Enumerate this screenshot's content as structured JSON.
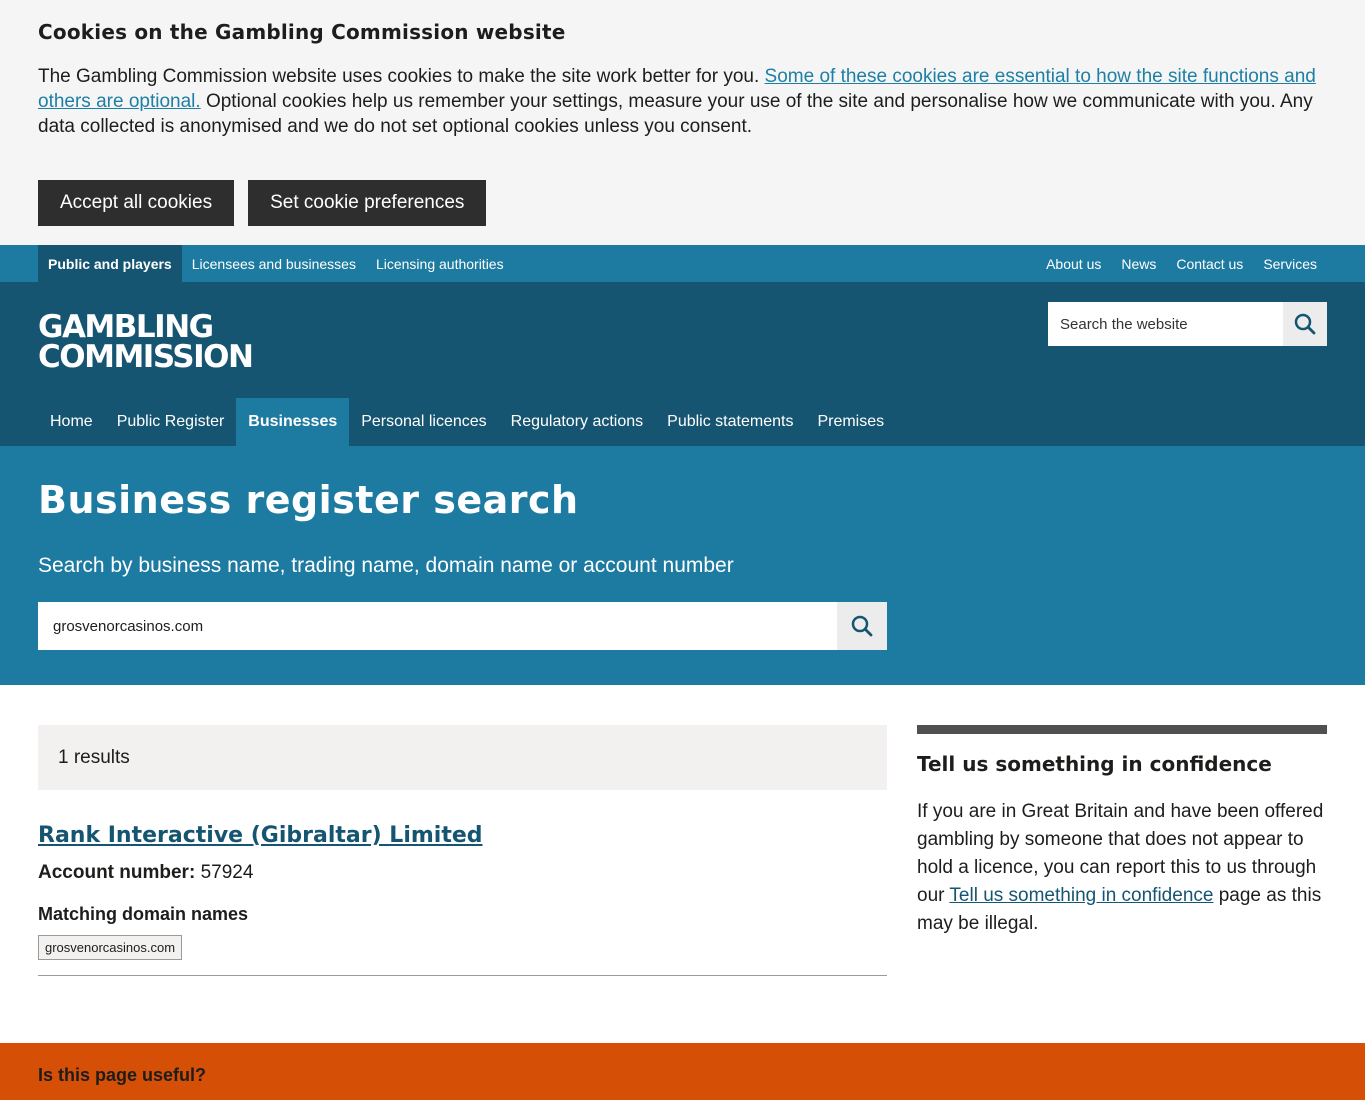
{
  "cookie_banner": {
    "title": "Cookies on the Gambling Commission website",
    "text_before": "The Gambling Commission website uses cookies to make the site work better for you. ",
    "link": "Some of these cookies are essential to how the site functions and others are optional.",
    "text_after": " Optional cookies help us remember your settings, measure your use of the site and personalise how we communicate with you. Any data collected is anonymised and we do not set optional cookies unless you consent.",
    "accept_label": "Accept all cookies",
    "prefs_label": "Set cookie preferences"
  },
  "topbar": {
    "audiences": [
      "Public and players",
      "Licensees and businesses",
      "Licensing authorities"
    ],
    "links": [
      "About us",
      "News",
      "Contact us",
      "Services"
    ]
  },
  "header": {
    "logo_line1": "GAMBLING",
    "logo_line2": "COMMISSION",
    "search_placeholder": "Search the website",
    "nav": [
      "Home",
      "Public Register",
      "Businesses",
      "Personal licences",
      "Regulatory actions",
      "Public statements",
      "Premises"
    ],
    "active_nav": "Businesses"
  },
  "hero": {
    "title": "Business register search",
    "subtitle": "Search by business name, trading name, domain name or account number",
    "search_value": "grosvenorcasinos.com"
  },
  "results": {
    "count_label": "1 results",
    "items": [
      {
        "name": "Rank Interactive (Gibraltar) Limited",
        "account_label": "Account number:",
        "account_number": "57924",
        "domains_label": "Matching domain names",
        "domains": [
          "grosvenorcasinos.com"
        ]
      }
    ]
  },
  "sidebar": {
    "title": "Tell us something in confidence",
    "text_before": "If you are in Great Britain and have been offered gambling by someone that does not appear to hold a licence, you can report this to us through our ",
    "link": "Tell us something in confidence",
    "text_after": " page as this may be illegal."
  },
  "feedback": {
    "question": "Is this page useful?"
  },
  "colors": {
    "cookie_bg": "#f5f5f5",
    "topbar": "#1d7ba1",
    "header": "#155571",
    "hero": "#1d7ba1",
    "feedback": "#d64f06"
  }
}
